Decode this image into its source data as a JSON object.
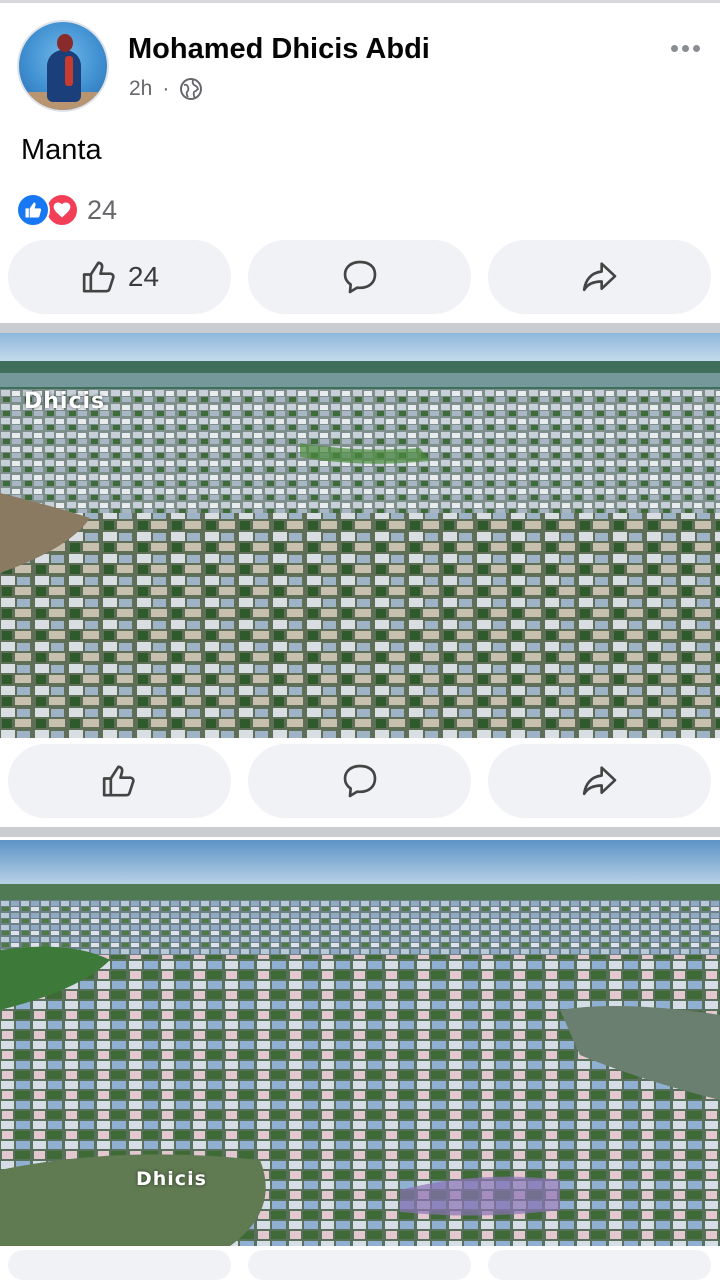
{
  "post": {
    "author": "Mohamed Dhicis Abdi",
    "time": "2h",
    "separator": "·",
    "privacy_icon": "globe-icon",
    "text": "Manta",
    "reaction_count": "24",
    "reaction_types": [
      "like-icon",
      "love-icon"
    ]
  },
  "actions": [
    {
      "name": "like",
      "icon": "thumbs-up-icon",
      "count": "24"
    },
    {
      "name": "comment",
      "icon": "comment-icon"
    },
    {
      "name": "share",
      "icon": "share-icon"
    }
  ],
  "photos": [
    {
      "watermark": "Dhicis",
      "actions": [
        {
          "name": "like",
          "icon": "thumbs-up-icon"
        },
        {
          "name": "comment",
          "icon": "comment-icon"
        },
        {
          "name": "share",
          "icon": "share-icon"
        }
      ]
    },
    {
      "watermark": "Dhicis"
    }
  ],
  "colors": {
    "like_blue": "#1877f2",
    "love_red": "#f33e58",
    "button_bg": "#f0f2f5",
    "secondary_text": "#65676b"
  }
}
